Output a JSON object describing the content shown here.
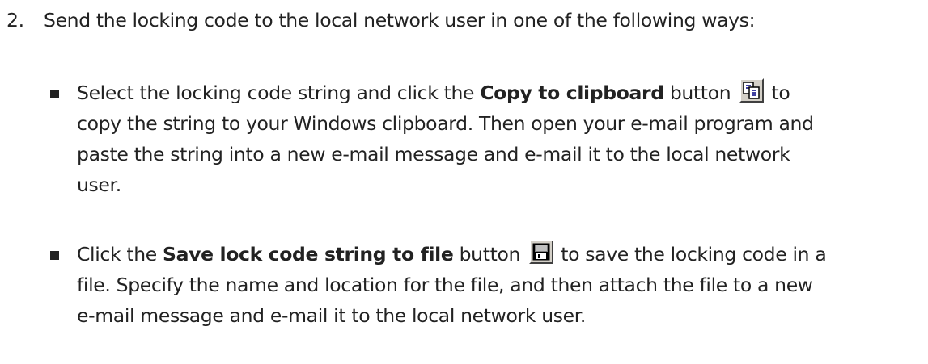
{
  "step": {
    "number": "2.",
    "text": "Send the locking code to the local network user in one of the following ways:"
  },
  "bullet1": {
    "line1_before": "Select the locking code string and click the ",
    "line1_bold": "Copy to clipboard",
    "line1_after_btn": " button ",
    "line1_end": " to",
    "line2": "copy the string to your Windows clipboard. Then open your e-mail program and",
    "line3": "paste the string into a new e-mail message and e-mail it to the local network",
    "line4": "user.",
    "icon": "copy-to-clipboard-icon"
  },
  "bullet2": {
    "line1_before": "Click the ",
    "line1_bold": "Save lock code string to file",
    "line1_after_btn": " button ",
    "line1_end": " to save the locking code in a",
    "line2": "file. Specify the name and location for the file, and then attach the file to a new",
    "line3": "e-mail message and e-mail it to the local network user.",
    "icon": "save-floppy-disk-icon"
  }
}
